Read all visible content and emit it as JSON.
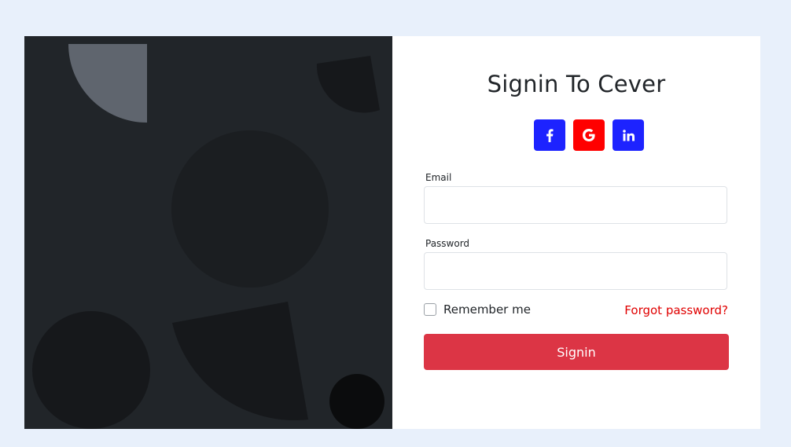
{
  "form": {
    "title": "Signin To Cever",
    "social": [
      {
        "name": "facebook-icon",
        "color": "#1d23ff"
      },
      {
        "name": "google-icon",
        "color": "#ff0000"
      },
      {
        "name": "linkedin-icon",
        "color": "#1d23ff"
      }
    ],
    "email_label": "Email",
    "email_value": "",
    "password_label": "Password",
    "password_value": "",
    "remember_label": "Remember me",
    "remember_checked": false,
    "forgot_label": "Forgot password?",
    "submit_label": "Signin"
  },
  "colors": {
    "page_background": "#e8f0fb",
    "art_background": "#212529",
    "accent": "#dc3545",
    "link": "#e00000"
  }
}
